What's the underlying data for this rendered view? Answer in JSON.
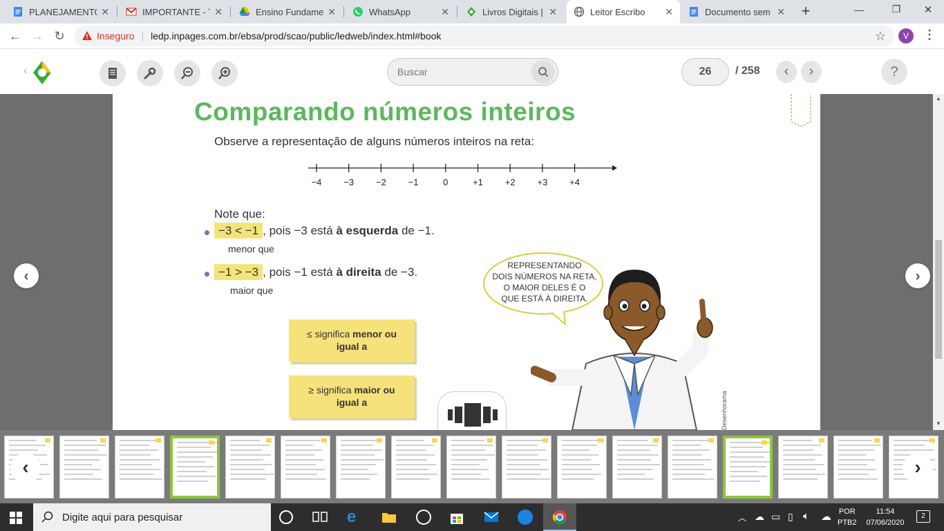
{
  "browser": {
    "tabs": [
      {
        "title": "PLANEJAMENTO S",
        "icon": "google-docs-icon",
        "color": "#4285f4"
      },
      {
        "title": "IMPORTANTE - TO",
        "icon": "gmail-icon",
        "color": "#d93025"
      },
      {
        "title": "Ensino Fundament",
        "icon": "google-drive-icon",
        "color": "#0f9d58"
      },
      {
        "title": "WhatsApp",
        "icon": "whatsapp-icon",
        "color": "#25d366"
      },
      {
        "title": "Livros Digitais | LE",
        "icon": "ledp-icon",
        "color": "#3aaa35"
      },
      {
        "title": "Leitor Escribo",
        "icon": "globe-icon",
        "color": "#5f6368",
        "active": true
      },
      {
        "title": "Documento sem tí",
        "icon": "google-docs-icon",
        "color": "#4285f4"
      }
    ],
    "new_tab": "+",
    "window_controls": {
      "minimize": "—",
      "maximize": "❐",
      "close": "✕"
    },
    "security_label": "Inseguro",
    "url": "ledp.inpages.com.br/ebsa/prod/scao/public/ledweb/index.html#book",
    "profile_initial": "V"
  },
  "reader": {
    "search_placeholder": "Buscar",
    "current_page": "26",
    "total_pages": "/ 258",
    "help": "?"
  },
  "book_page": {
    "title": "Comparando números inteiros",
    "intro": "Observe a representação de alguns números inteiros na reta:",
    "number_line_labels": [
      "−4",
      "−3",
      "−2",
      "−1",
      "0",
      "+1",
      "+2",
      "+3",
      "+4"
    ],
    "note_heading": "Note que:",
    "bullet1": {
      "expr": "−3 < −1",
      "text_a": ", pois −3 está ",
      "bold": "à esquerda",
      "text_b": " de −1.",
      "caption": "menor que"
    },
    "bullet2": {
      "expr": "−1 > −3",
      "text_a": ", pois −1 está ",
      "bold": "à direita",
      "text_b": " de −3.",
      "caption": "maior que"
    },
    "note_le": {
      "symbol": "≤",
      "pre": " significa ",
      "bold": "menor ou",
      "post": "igual a"
    },
    "note_ge": {
      "symbol": "≥",
      "pre": " significa ",
      "bold": "maior ou",
      "post": "igual a"
    },
    "speech": [
      "REPRESENTANDO",
      "DOIS NÚMEROS NA RETA,",
      "O MAIOR DELES É O",
      "QUE ESTÁ À DIREITA."
    ],
    "credit": "Desenhorama"
  },
  "taskbar": {
    "search_placeholder": "Digite aqui para pesquisar",
    "lang": "POR",
    "layout": "PTB2",
    "time": "11:54",
    "date": "07/06/2020",
    "notifications": "2"
  },
  "colors": {
    "green_title": "#5cb85c",
    "highlight": "#f3e47a",
    "bullet": "#8e6aa8"
  }
}
